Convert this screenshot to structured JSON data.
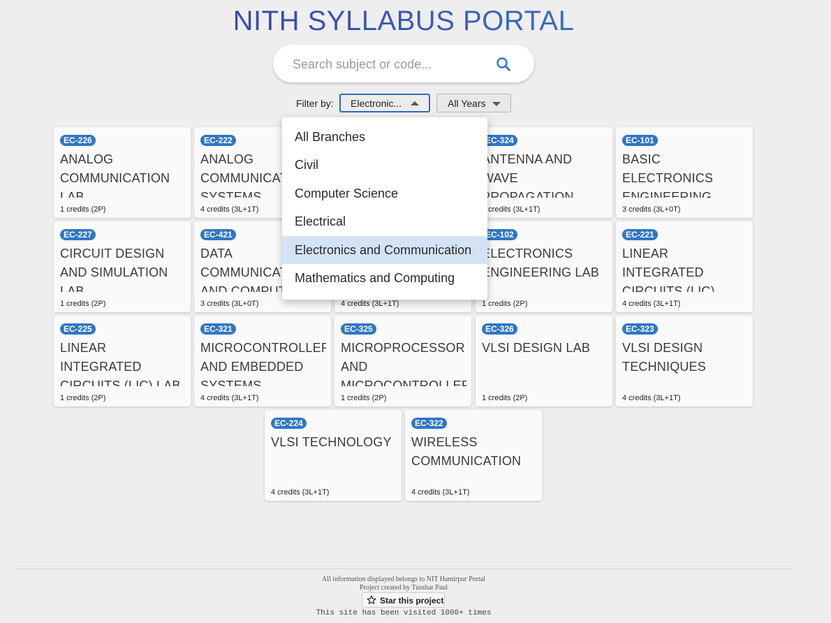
{
  "header": {
    "title": "NITH SYLLABUS PORTAL"
  },
  "search": {
    "placeholder": "Search subject or code...",
    "value": ""
  },
  "filters": {
    "label": "Filter by:",
    "branch_selected": "Electronic...",
    "year_selected": "All Years"
  },
  "branch_dropdown": {
    "options": [
      "All Branches",
      "Civil",
      "Computer Science",
      "Electrical",
      "Electronics and Communication",
      "Mathematics and Computing"
    ],
    "selected_index": 4
  },
  "subjects": [
    {
      "code": "EC-226",
      "name": "ANALOG COMMUNICATION LAB",
      "credits": "1 credits (2P)"
    },
    {
      "code": "EC-222",
      "name": "ANALOG COMMUNICATION SYSTEMS",
      "credits": "4 credits (3L+1T)"
    },
    {
      "code": "",
      "name": "",
      "credits": ""
    },
    {
      "code": "EC-324",
      "name": "ANTENNA AND WAVE PROPAGATION",
      "credits": "4 credits (3L+1T)"
    },
    {
      "code": "EC-101",
      "name": "BASIC ELECTRONICS ENGINEERING",
      "credits": "3 credits (3L+0T)"
    },
    {
      "code": "EC-227",
      "name": "CIRCUIT DESIGN AND SIMULATION LAB",
      "credits": "1 credits (2P)"
    },
    {
      "code": "EC-421",
      "name": "DATA COMMUNICATION AND COMPUTER",
      "credits": "3 credits (3L+0T)"
    },
    {
      "code": "",
      "name": "",
      "credits": "4 credits (3L+1T)"
    },
    {
      "code": "EC-102",
      "name": "ELECTRONICS ENGINEERING LAB",
      "credits": "1 credits (2P)"
    },
    {
      "code": "EC-221",
      "name": "LINEAR INTEGRATED CIRCUITS (LIC)",
      "credits": "4 credits (3L+1T)"
    },
    {
      "code": "EC-225",
      "name": "LINEAR INTEGRATED CIRCUITS (LIC) LAB",
      "credits": "1 credits (2P)"
    },
    {
      "code": "EC-321",
      "name": "MICROCONTROLLER AND EMBEDDED SYSTEMS",
      "credits": "4 credits (3L+1T)"
    },
    {
      "code": "EC-325",
      "name": "MICROPROCESSOR AND MICROCONTROLLER",
      "credits": "1 credits (2P)"
    },
    {
      "code": "EC-326",
      "name": "VLSI DESIGN LAB",
      "credits": "1 credits (2P)"
    },
    {
      "code": "EC-323",
      "name": "VLSI DESIGN TECHNIQUES",
      "credits": "4 credits (3L+1T)"
    },
    {
      "code": "EC-224",
      "name": "VLSI TECHNOLOGY",
      "credits": "4 credits (3L+1T)"
    },
    {
      "code": "EC-322",
      "name": "WIRELESS COMMUNICATION",
      "credits": "4 credits (3L+1T)"
    }
  ],
  "footer": {
    "disclaimer": "All information displayed belongs to NIT Hamirpur Portal",
    "credit": "Project created by Tusshar Paul",
    "star_label": "Star this project",
    "visits": "This site has been visited 1000+ times"
  },
  "colors": {
    "accent": "#2f77c6",
    "selected_option": "#d3e3f5",
    "title_start": "#3a3a9e",
    "title_end": "#3a8ad8"
  },
  "icons": {
    "search": "search-icon",
    "star": "star-icon",
    "branch_arrow": "caret-up-icon",
    "year_arrow": "caret-down-icon"
  }
}
